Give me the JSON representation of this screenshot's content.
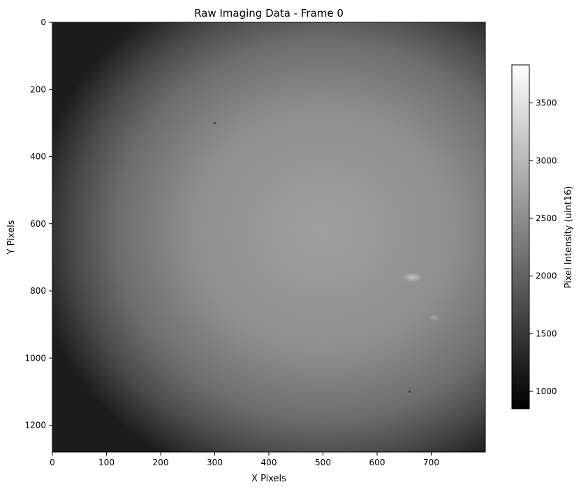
{
  "chart_data": {
    "type": "heatmap",
    "title": "Raw Imaging Data - Frame 0",
    "xlabel": "X Pixels",
    "ylabel": "Y Pixels",
    "xlim": [
      0,
      800
    ],
    "ylim": [
      1280,
      0
    ],
    "x_ticks": [
      0,
      100,
      200,
      300,
      400,
      500,
      600,
      700
    ],
    "y_ticks": [
      0,
      200,
      400,
      600,
      800,
      1000,
      1200
    ],
    "colormap": "gray",
    "colorbar": {
      "label": "Pixel Intensity (uint16)",
      "range": [
        850,
        3830
      ],
      "ticks": [
        1000,
        1500,
        2000,
        2500,
        3000,
        3500
      ]
    },
    "image_summary": {
      "center": [
        470,
        620
      ],
      "center_intensity": 2700,
      "corner_intensity": 1000,
      "bright_spot": {
        "x": 665,
        "y": 760,
        "intensity": 3000
      },
      "dark_specks": [
        {
          "x": 300,
          "y": 300
        },
        {
          "x": 660,
          "y": 1100
        }
      ]
    }
  }
}
